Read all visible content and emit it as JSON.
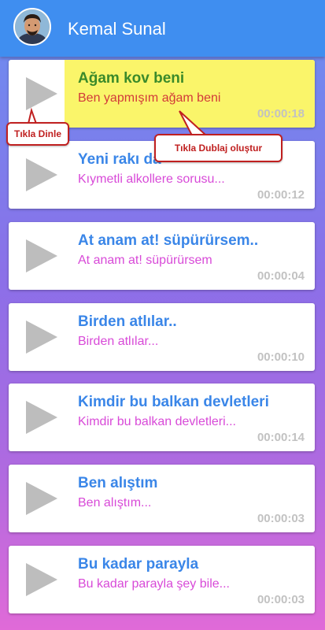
{
  "header": {
    "title": "Kemal Sunal",
    "avatar_icon": "person-portrait-icon",
    "background": "#3f8ef0"
  },
  "colors": {
    "title": "#3a86e8",
    "subtitle": "#d84ad8",
    "duration": "#c2c2c2",
    "highlight_bg": "#faf56a",
    "highlight_title": "#3b8a2a",
    "highlight_subtitle": "#d23a3a",
    "tooltip": "#c02020"
  },
  "items": [
    {
      "title": "Ağam kov beni",
      "subtitle": "Ben yapmışım ağam beni",
      "duration": "00:00:18",
      "highlighted": true
    },
    {
      "title": "Yeni rakı da",
      "subtitle": "Kıymetli alkollere sorusu...",
      "duration": "00:00:12",
      "highlighted": false
    },
    {
      "title": "At anam at! süpürürsem..",
      "subtitle": "At anam at! süpürürsem",
      "duration": "00:00:04",
      "highlighted": false
    },
    {
      "title": "Birden atlılar..",
      "subtitle": "Birden atlılar...",
      "duration": "00:00:10",
      "highlighted": false
    },
    {
      "title": "Kimdir bu balkan devletleri",
      "subtitle": "Kimdir bu balkan devletleri...",
      "duration": "00:00:14",
      "highlighted": false
    },
    {
      "title": "Ben alıştım",
      "subtitle": "Ben alıştım...",
      "duration": "00:00:03",
      "highlighted": false
    },
    {
      "title": "Bu kadar parayla",
      "subtitle": "Bu kadar parayla şey bile...",
      "duration": "00:00:03",
      "highlighted": false
    }
  ],
  "tooltips": {
    "listen": "Tıkla Dinle",
    "dub": "Tıkla Dublaj oluştur"
  },
  "icons": {
    "play": "play-icon"
  }
}
